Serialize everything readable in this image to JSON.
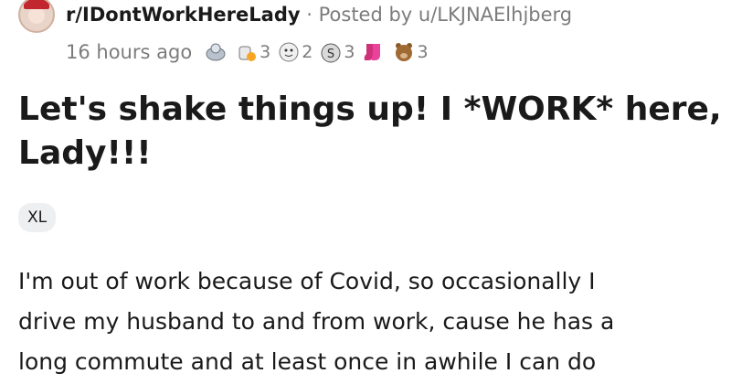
{
  "post": {
    "subreddit": "r/IDontWorkHereLady",
    "separator": "·",
    "posted_by": "Posted by u/LKJNAElhjberg",
    "time_ago": "16 hours ago",
    "awards": [
      {
        "icon": "wholesome-seal-award-icon",
        "count": ""
      },
      {
        "icon": "helpful-thumbs-award-icon",
        "count": "3"
      },
      {
        "icon": "face-award-icon",
        "count": "2"
      },
      {
        "icon": "money-bag-award-icon",
        "count": "3"
      },
      {
        "icon": "pink-socks-award-icon",
        "count": ""
      },
      {
        "icon": "bear-award-icon",
        "count": "3"
      }
    ],
    "title_line1": "Let's shake things up! I *WORK* here,",
    "title_line2": "Lady!!!",
    "flair": "XL",
    "body_lines": [
      "I'm out of work because of Covid, so occasionally I",
      "drive my husband to and from work, cause he has a",
      "long commute and at least once in awhile I can do"
    ]
  }
}
